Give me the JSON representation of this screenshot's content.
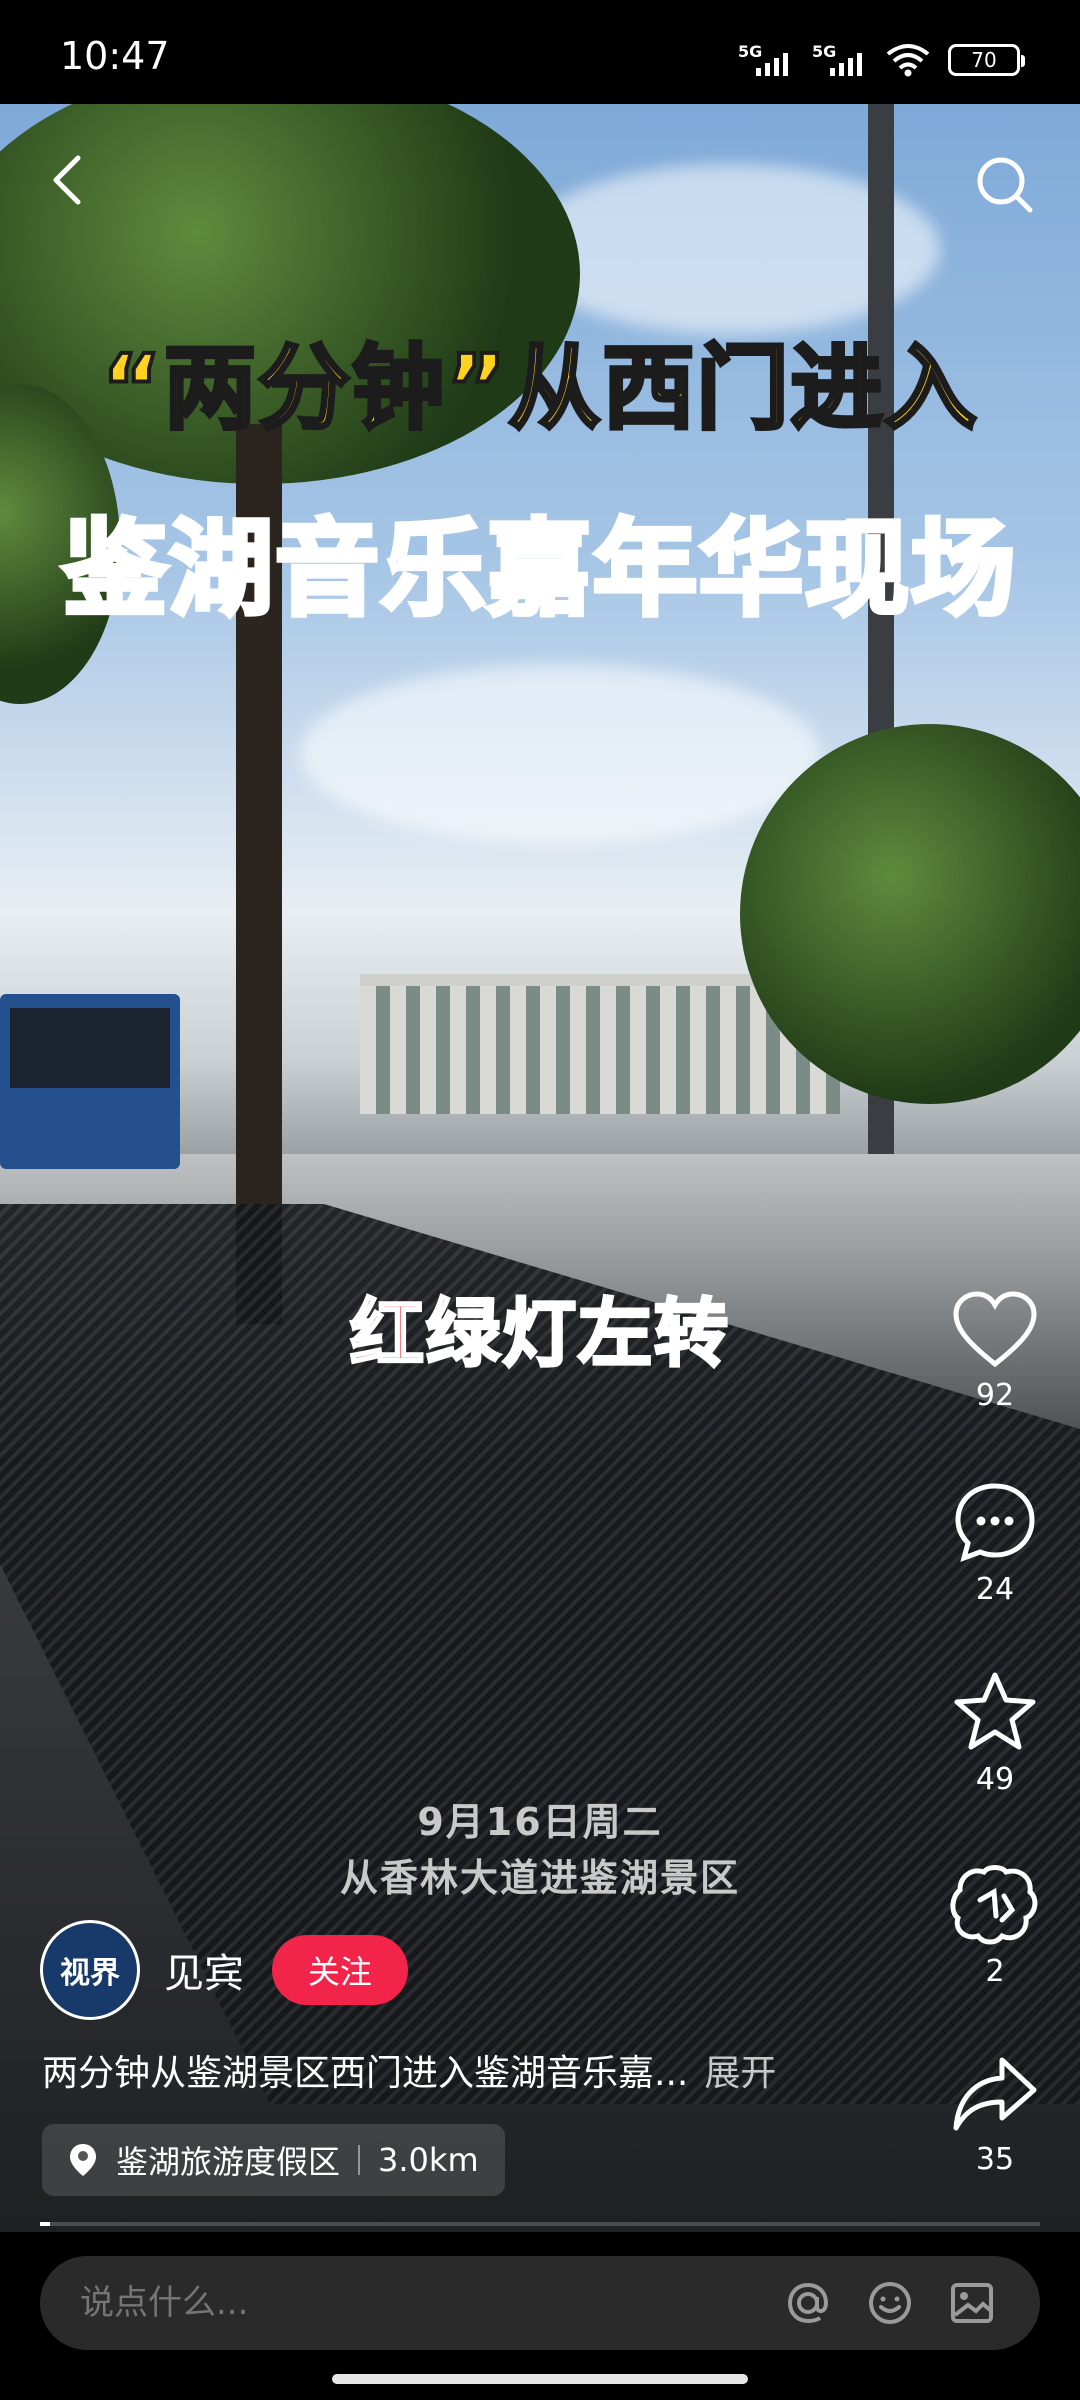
{
  "status_bar": {
    "time": "10:47",
    "network1": "5G",
    "network2": "5G",
    "battery": "70"
  },
  "video": {
    "title_line1": "“两分钟”从西门进入",
    "title_line2": "鉴湖音乐嘉年华现场",
    "caption_mid": {
      "part_red": "红",
      "part_green": "绿",
      "part_rest": "灯左转"
    },
    "caption_date_line1": "9月16日周二",
    "caption_date_line2": "从香林大道进鉴湖景区",
    "progress": 0.01
  },
  "actions": {
    "like_count": "92",
    "comment_count": "24",
    "favorite_count": "49",
    "gift_count": "2",
    "share_count": "35"
  },
  "author": {
    "avatar_text": "视界",
    "name": "见宾",
    "follow_label": "关注"
  },
  "description": {
    "text": "两分钟从鉴湖景区西门进入鉴湖音乐嘉...",
    "more_label": "展开"
  },
  "location": {
    "name": "鉴湖旅游度假区",
    "distance": "3.0km"
  },
  "comment_bar": {
    "placeholder": "说点什么..."
  },
  "colors": {
    "follow": "#f2244a",
    "title_yellow": "#ffd21f",
    "title_blue": "#2e9cf3"
  }
}
